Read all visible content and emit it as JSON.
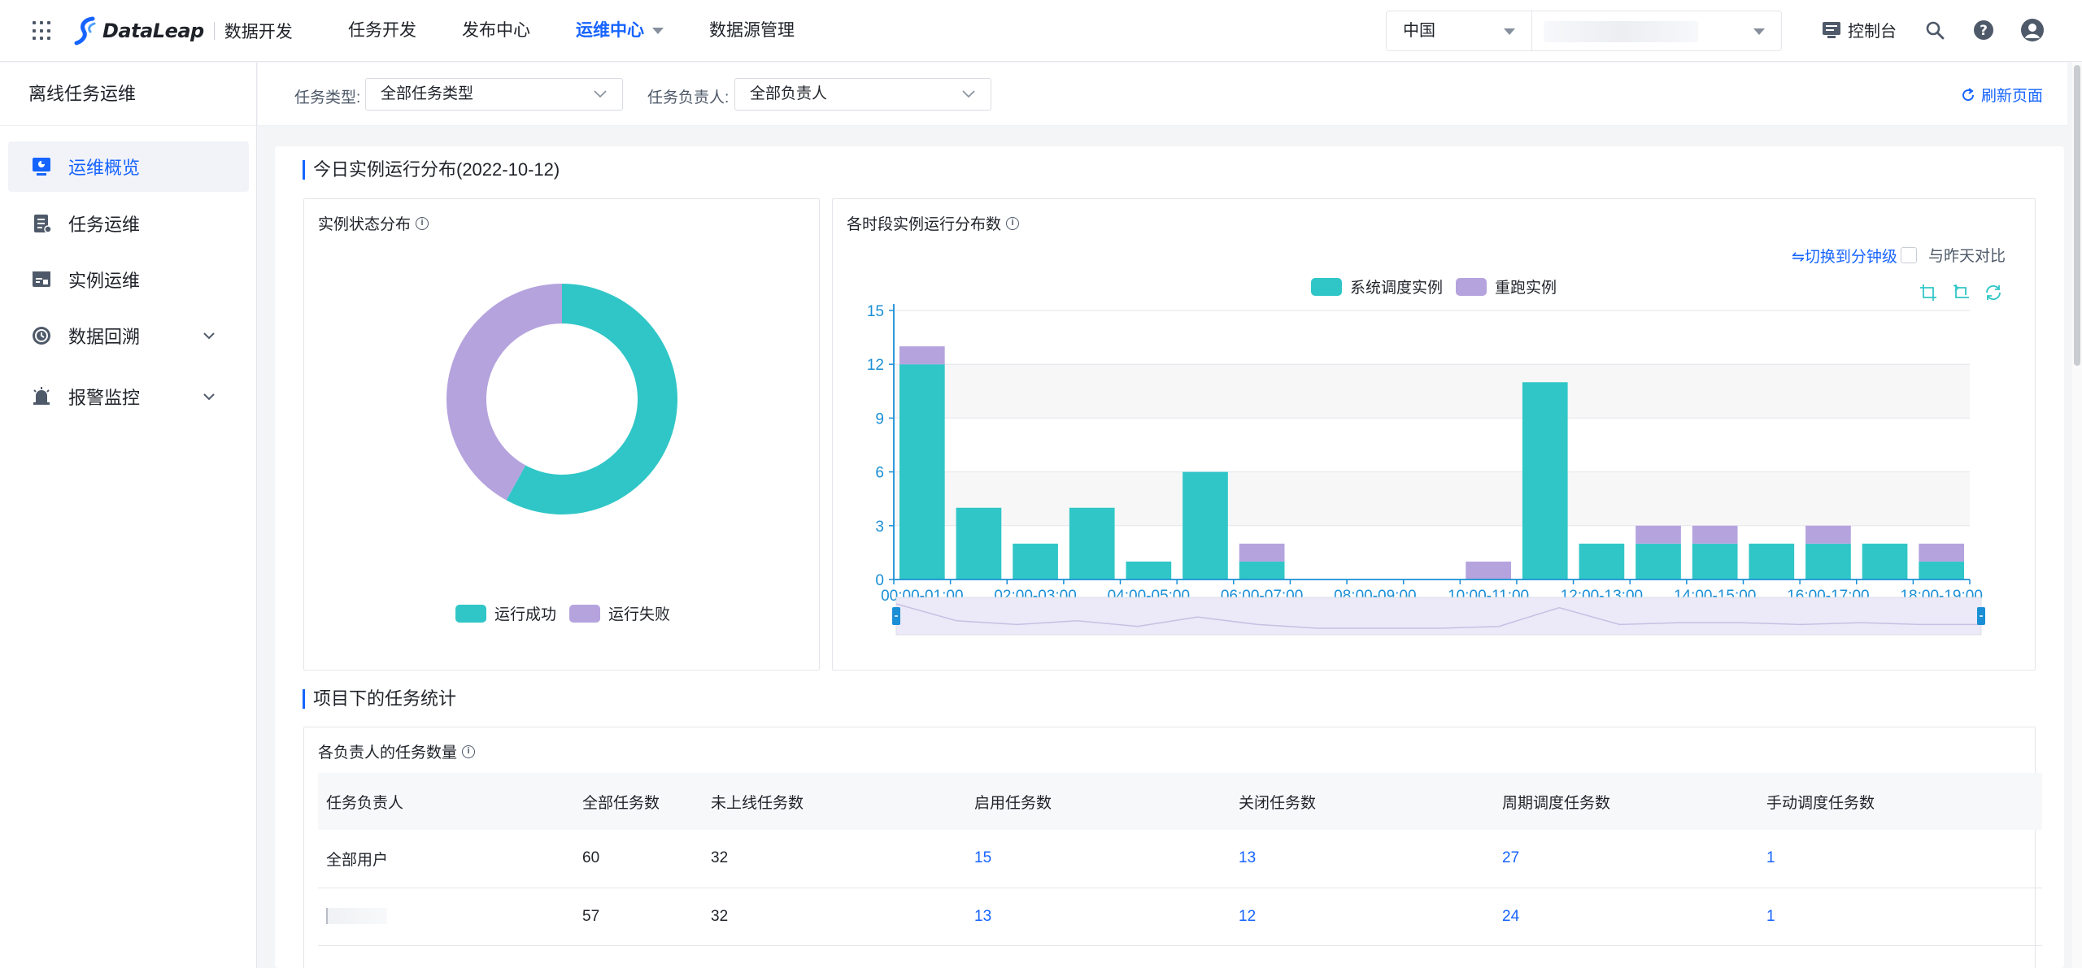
{
  "header": {
    "logo_text": "DataLeap",
    "product_name": "数据开发",
    "nav": [
      "任务开发",
      "发布中心",
      "运维中心",
      "数据源管理"
    ],
    "active_nav": "运维中心",
    "region": "中国",
    "project_value": "",
    "console_label": "控制台",
    "icons": [
      "apps-grid-icon",
      "search-icon",
      "help-icon",
      "user-avatar-icon"
    ]
  },
  "sidebar": {
    "title": "离线任务运维",
    "items": [
      {
        "label": "运维概览",
        "icon": "overview-icon",
        "active": true,
        "expandable": false
      },
      {
        "label": "任务运维",
        "icon": "task-icon",
        "active": false,
        "expandable": false
      },
      {
        "label": "实例运维",
        "icon": "instance-icon",
        "active": false,
        "expandable": false
      },
      {
        "label": "数据回溯",
        "icon": "backfill-icon",
        "active": false,
        "expandable": true
      },
      {
        "label": "报警监控",
        "icon": "alarm-icon",
        "active": false,
        "expandable": true
      }
    ]
  },
  "filters": {
    "task_type_label": "任务类型:",
    "task_type_value": "全部任务类型",
    "owner_label": "任务负责人:",
    "owner_value": "全部负责人",
    "refresh_label": "刷新页面"
  },
  "section1": {
    "title": "今日实例运行分布(2022-10-12)",
    "donut_title": "实例状态分布",
    "bar_title": "各时段实例运行分布数",
    "switch_link": "⇋切换到分钟级",
    "compare_label": "与昨天对比"
  },
  "chart_data": [
    {
      "type": "pie",
      "title": "实例状态分布",
      "donut": true,
      "series": [
        {
          "name": "运行成功",
          "value": 58
        },
        {
          "name": "运行失败",
          "value": 42
        }
      ],
      "colors": [
        "#30c6c7",
        "#b5a3de"
      ],
      "legend": "bottom"
    },
    {
      "type": "bar",
      "stacked": true,
      "title": "各时段实例运行分布数",
      "categories": [
        "00:00-01:00",
        "01:00-02:00",
        "02:00-03:00",
        "03:00-04:00",
        "04:00-05:00",
        "05:00-06:00",
        "06:00-07:00",
        "07:00-08:00",
        "08:00-09:00",
        "09:00-10:00",
        "10:00-11:00",
        "11:00-12:00",
        "12:00-13:00",
        "13:00-14:00",
        "14:00-15:00",
        "15:00-16:00",
        "16:00-17:00",
        "17:00-18:00",
        "18:00-19:00"
      ],
      "tick_labels": [
        "00:00-01:00",
        "02:00-03:00",
        "04:00-05:00",
        "06:00-07:00",
        "08:00-09:00",
        "10:00-11:00",
        "12:00-13:00",
        "14:00-15:00",
        "16:00-17:00",
        "18:00-19:00"
      ],
      "series": [
        {
          "name": "系统调度实例",
          "color": "#30c6c7",
          "values": [
            12,
            4,
            2,
            4,
            1,
            6,
            1,
            0,
            0,
            0,
            0,
            11,
            2,
            2,
            2,
            2,
            2,
            2,
            1
          ]
        },
        {
          "name": "重跑实例",
          "color": "#b5a3de",
          "values": [
            1,
            0,
            0,
            0,
            0,
            0,
            1,
            0,
            0,
            0,
            1,
            0,
            0,
            1,
            1,
            0,
            1,
            0,
            1
          ]
        }
      ],
      "ylim": [
        0,
        15
      ],
      "yticks": [
        0,
        3,
        6,
        9,
        12,
        15
      ],
      "grid": true,
      "legend": "top-center",
      "dataZoom": true
    }
  ],
  "section2": {
    "title": "项目下的任务统计",
    "table_title": "各负责人的任务数量",
    "columns": [
      "任务负责人",
      "全部任务数",
      "未上线任务数",
      "启用任务数",
      "关闭任务数",
      "周期调度任务数",
      "手动调度任务数"
    ],
    "rows": [
      [
        "全部用户",
        "60",
        "32",
        "15",
        "13",
        "27",
        "1"
      ],
      [
        "",
        "57",
        "32",
        "13",
        "12",
        "24",
        "1"
      ]
    ]
  }
}
